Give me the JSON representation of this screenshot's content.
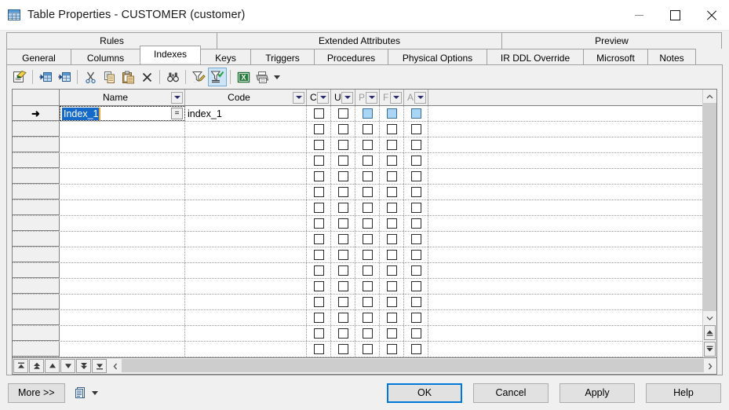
{
  "window": {
    "title": "Table Properties - CUSTOMER (customer)",
    "icon": "table-grid-icon",
    "minimize_label": "Minimize",
    "maximize_label": "Maximize",
    "close_label": "Close"
  },
  "tabs": {
    "row1": [
      {
        "label": "Rules",
        "active": false
      },
      {
        "label": "Extended Attributes",
        "active": false
      },
      {
        "label": "Preview",
        "active": false
      }
    ],
    "row2": [
      {
        "label": "General",
        "active": false
      },
      {
        "label": "Columns",
        "active": false
      },
      {
        "label": "Indexes",
        "active": true
      },
      {
        "label": "Keys",
        "active": false
      },
      {
        "label": "Triggers",
        "active": false
      },
      {
        "label": "Procedures",
        "active": false
      },
      {
        "label": "Physical Options",
        "active": false
      },
      {
        "label": "IR DDL Override",
        "active": false
      },
      {
        "label": "Microsoft",
        "active": false
      },
      {
        "label": "Notes",
        "active": false
      }
    ]
  },
  "toolbar": {
    "buttons": [
      {
        "name": "properties-icon",
        "tooltip": "Properties"
      },
      {
        "name": "insert-row-icon",
        "tooltip": "Insert a Row"
      },
      {
        "name": "add-row-icon",
        "tooltip": "Add a Row"
      },
      {
        "name": "cut-icon",
        "tooltip": "Cut"
      },
      {
        "name": "copy-icon",
        "tooltip": "Copy"
      },
      {
        "name": "paste-icon",
        "tooltip": "Paste"
      },
      {
        "name": "delete-icon",
        "tooltip": "Delete"
      },
      {
        "name": "find-icon",
        "tooltip": "Find"
      },
      {
        "name": "edit-filter-icon",
        "tooltip": "Customize Columns and Filter"
      },
      {
        "name": "apply-filter-icon",
        "tooltip": "Apply Filter",
        "pressed": true
      },
      {
        "name": "excel-export-icon",
        "tooltip": "Export to Excel"
      },
      {
        "name": "print-icon",
        "tooltip": "Print"
      },
      {
        "name": "toolbar-dropdown-icon",
        "tooltip": "More"
      }
    ]
  },
  "grid": {
    "columns": [
      {
        "key": "name",
        "label": "Name",
        "dim": false,
        "filter": true
      },
      {
        "key": "code",
        "label": "Code",
        "dim": false,
        "filter": true
      },
      {
        "key": "c",
        "label": "C",
        "dim": false,
        "filter": true
      },
      {
        "key": "u",
        "label": "U",
        "dim": false,
        "filter": true
      },
      {
        "key": "p",
        "label": "P",
        "dim": true,
        "filter": true
      },
      {
        "key": "f",
        "label": "F",
        "dim": true,
        "filter": true
      },
      {
        "key": "a",
        "label": "A",
        "dim": true,
        "filter": true
      }
    ],
    "rows": [
      {
        "current": true,
        "editing": true,
        "name": "Index_1",
        "code": "index_1",
        "c": false,
        "u": false,
        "p": "blue",
        "f": "blue",
        "a": "blue"
      },
      {
        "current": false,
        "name": "",
        "code": "",
        "c": false,
        "u": false,
        "p": false,
        "f": false,
        "a": false
      },
      {
        "current": false,
        "name": "",
        "code": "",
        "c": false,
        "u": false,
        "p": false,
        "f": false,
        "a": false
      },
      {
        "current": false,
        "name": "",
        "code": "",
        "c": false,
        "u": false,
        "p": false,
        "f": false,
        "a": false
      },
      {
        "current": false,
        "name": "",
        "code": "",
        "c": false,
        "u": false,
        "p": false,
        "f": false,
        "a": false
      },
      {
        "current": false,
        "name": "",
        "code": "",
        "c": false,
        "u": false,
        "p": false,
        "f": false,
        "a": false
      },
      {
        "current": false,
        "name": "",
        "code": "",
        "c": false,
        "u": false,
        "p": false,
        "f": false,
        "a": false
      },
      {
        "current": false,
        "name": "",
        "code": "",
        "c": false,
        "u": false,
        "p": false,
        "f": false,
        "a": false
      },
      {
        "current": false,
        "name": "",
        "code": "",
        "c": false,
        "u": false,
        "p": false,
        "f": false,
        "a": false
      },
      {
        "current": false,
        "name": "",
        "code": "",
        "c": false,
        "u": false,
        "p": false,
        "f": false,
        "a": false
      },
      {
        "current": false,
        "name": "",
        "code": "",
        "c": false,
        "u": false,
        "p": false,
        "f": false,
        "a": false
      },
      {
        "current": false,
        "name": "",
        "code": "",
        "c": false,
        "u": false,
        "p": false,
        "f": false,
        "a": false
      },
      {
        "current": false,
        "name": "",
        "code": "",
        "c": false,
        "u": false,
        "p": false,
        "f": false,
        "a": false
      },
      {
        "current": false,
        "name": "",
        "code": "",
        "c": false,
        "u": false,
        "p": false,
        "f": false,
        "a": false
      },
      {
        "current": false,
        "name": "",
        "code": "",
        "c": false,
        "u": false,
        "p": false,
        "f": false,
        "a": false
      },
      {
        "current": false,
        "name": "",
        "code": "",
        "c": false,
        "u": false,
        "p": false,
        "f": false,
        "a": false
      }
    ],
    "edit_cell": {
      "selected_text": "Index_1",
      "ellipsis_label": "="
    }
  },
  "navigation": {
    "buttons": [
      {
        "name": "nav-first-icon",
        "tooltip": "First"
      },
      {
        "name": "nav-page-up-icon",
        "tooltip": "Previous Page"
      },
      {
        "name": "nav-up-icon",
        "tooltip": "Previous"
      },
      {
        "name": "nav-down-icon",
        "tooltip": "Next"
      },
      {
        "name": "nav-page-down-icon",
        "tooltip": "Next Page"
      },
      {
        "name": "nav-last-icon",
        "tooltip": "Last"
      }
    ]
  },
  "scrollbars": {
    "vertical": {
      "up": "chevron-up-icon",
      "down": "chevron-down-icon",
      "extra_up": "scroll-top-icon",
      "extra_down": "scroll-bottom-icon"
    },
    "horizontal": {
      "left": "chevron-left-icon",
      "right": "chevron-right-icon"
    }
  },
  "footer": {
    "more_label": "More >>",
    "report_icon": "report-icon",
    "report_caret": "dropdown-caret-icon",
    "buttons": [
      {
        "label": "OK",
        "focused": true
      },
      {
        "label": "Cancel",
        "focused": false
      },
      {
        "label": "Apply",
        "focused": false
      },
      {
        "label": "Help",
        "focused": false
      }
    ]
  },
  "colors": {
    "accent": "#0078d7",
    "selection": "#1569c7",
    "checkbox_blue": "#a9d6f5",
    "window_bg": "#f0f0f0",
    "grid_bg": "#ffffff"
  }
}
